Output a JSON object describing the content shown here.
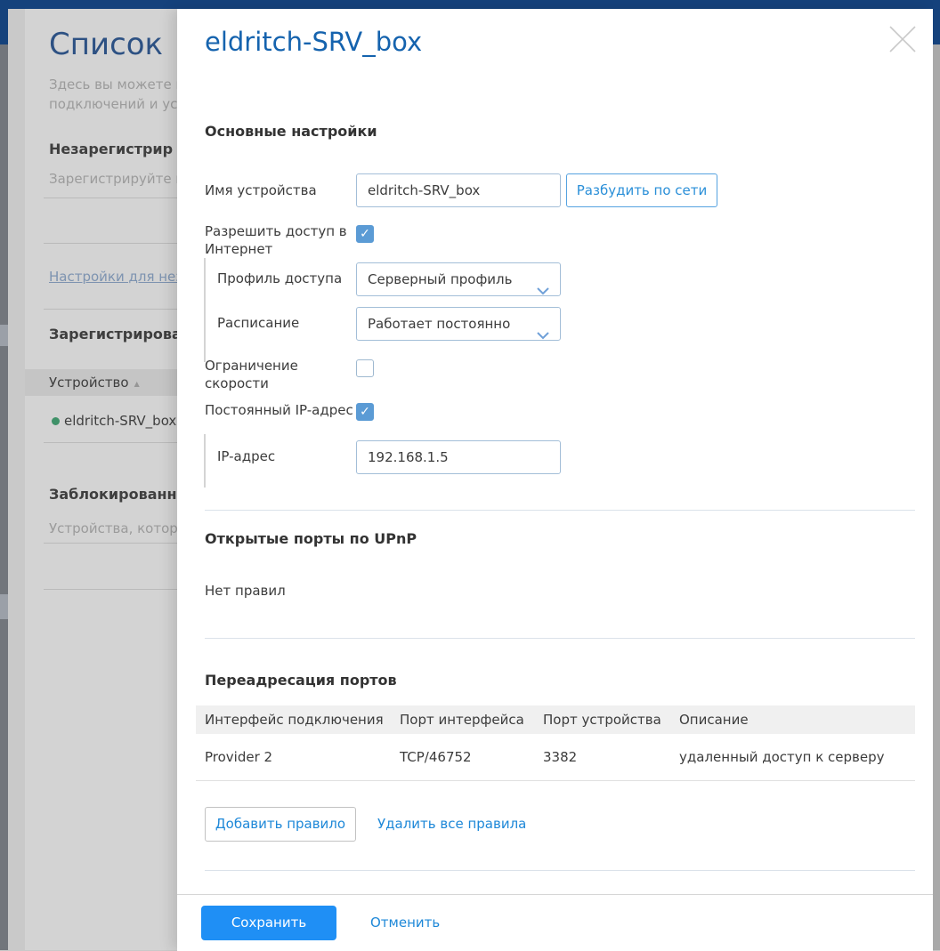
{
  "page": {
    "title": "Список",
    "subtitle_line1": "Здесь вы можете по",
    "subtitle_line2": "подключений и уст",
    "unregistered_heading": "Незарегистрир",
    "unregistered_text": "Зарегистрируйте ва",
    "unregistered_link": "Настройки для неза",
    "registered_heading": "Зарегистрирова",
    "device_column_header": "Устройство",
    "device_name": "eldritch-SRV_box",
    "blocked_heading": "Заблокированн",
    "blocked_text": "Устройства, которы"
  },
  "panel": {
    "title": "eldritch-SRV_box",
    "main_heading": "Основные настройки",
    "device_name_label": "Имя устройства",
    "device_name_value": "eldritch-SRV_box",
    "wake_button": "Разбудить по сети",
    "internet_label1": "Разрешить доступ в",
    "internet_label2": "Интернет",
    "internet_checked": true,
    "profile_label": "Профиль доступа",
    "profile_value": "Серверный профиль",
    "schedule_label": "Расписание",
    "schedule_value": "Работает постоянно",
    "speed_label1": "Ограничение",
    "speed_label2": "скорости",
    "speed_checked": false,
    "staticip_label": "Постоянный IP-адрес",
    "staticip_checked": true,
    "ip_label": "IP-адрес",
    "ip_value": "192.168.1.5",
    "upnp_heading": "Открытые порты по UPnP",
    "upnp_empty": "Нет правил",
    "pf_heading": "Переадресация портов",
    "pf_headers": [
      "Интерфейс подключения",
      "Порт интерфейса",
      "Порт устройства",
      "Описание"
    ],
    "pf_rows": [
      [
        "Provider 2",
        "TCP/46752",
        "3382",
        "удаленный доступ к серверу"
      ]
    ],
    "add_rule_button": "Добавить правило",
    "delete_all_link": "Удалить все правила",
    "save_button": "Сохранить",
    "cancel_link": "Отменить"
  },
  "colors": {
    "header_navy": "#15427c",
    "panel_title_blue": "#1563ae",
    "accent_blue": "#1e88d8",
    "checkbox_blue": "#5b9bd5",
    "save_button_blue": "#1f8ff5",
    "input_border": "#a3bed8",
    "status_green": "#3f9168"
  }
}
